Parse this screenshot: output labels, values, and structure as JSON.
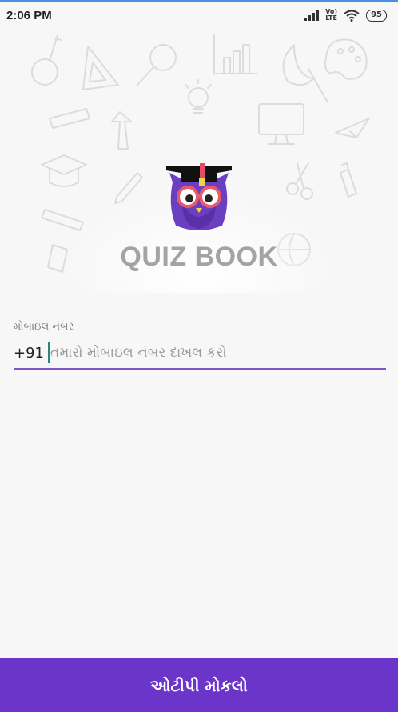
{
  "status_bar": {
    "time": "2:06 PM",
    "volte_top": "Vo)",
    "volte_bottom": "LTE",
    "battery": "95",
    "icons": [
      "signal-icon",
      "volte-icon",
      "wifi-icon",
      "battery-icon"
    ]
  },
  "brand": {
    "name": "QUIZ BOOK",
    "logo": "owl-graduate-logo",
    "colors": {
      "owl_purple": "#7e57c2",
      "owl_dark": "#5a2fa8",
      "glasses": "#e85a6a",
      "cap": "#111111",
      "tassel": "#f0d24a"
    }
  },
  "login_form": {
    "label": "મોબાઇલ નંબર",
    "country_code": "+91",
    "placeholder": "તમારો મોબાઇલ નંબર દાખલ કરો",
    "value": ""
  },
  "actions": {
    "send_otp_label": "ઓટીપી મોકલો"
  },
  "colors": {
    "accent": "#6a35c8",
    "underline": "#7e57c2",
    "cursor": "#26867a",
    "background": "#f7f7f7"
  }
}
